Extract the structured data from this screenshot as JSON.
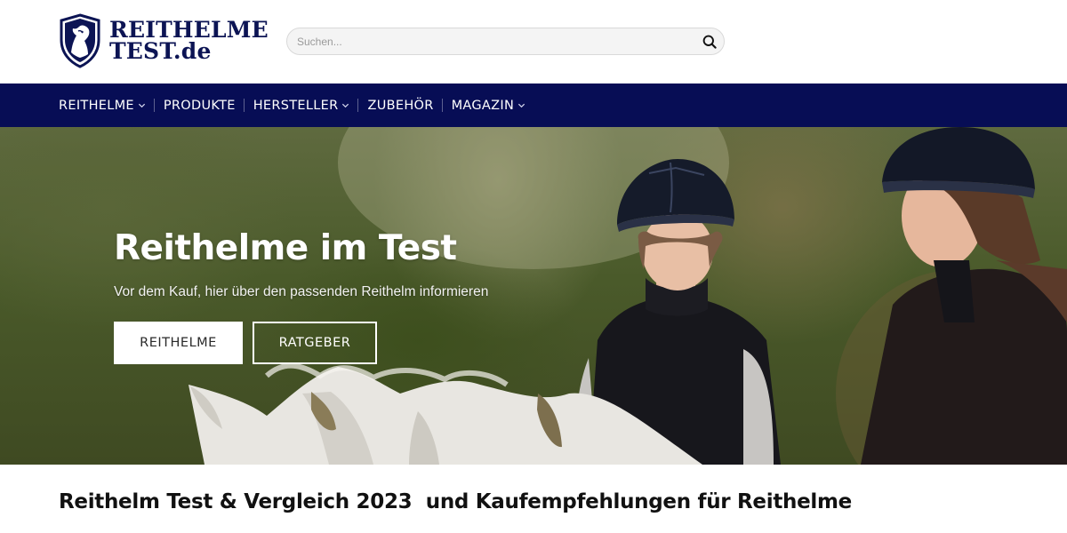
{
  "header": {
    "logo": {
      "line1": "REITHELME",
      "line2": "TEST.de",
      "icon": "horse-shield-icon"
    },
    "search": {
      "placeholder": "Suchen...",
      "icon": "search-icon"
    }
  },
  "nav": {
    "items": [
      {
        "label": "REITHELME",
        "has_dropdown": true
      },
      {
        "label": "PRODUKTE",
        "has_dropdown": false
      },
      {
        "label": "HERSTELLER",
        "has_dropdown": true
      },
      {
        "label": "ZUBEHÖR",
        "has_dropdown": false
      },
      {
        "label": "MAGAZIN",
        "has_dropdown": true
      }
    ]
  },
  "hero": {
    "title": "Reithelme im Test",
    "subtitle": "Vor dem Kauf, hier über den passenden Reithelm informieren",
    "primary_button": "REITHELME",
    "secondary_button": "RATGEBER"
  },
  "content": {
    "heading": "Reithelm Test & Vergleich 2023  und Kaufempfehlungen für Reithelme"
  },
  "colors": {
    "brand_navy": "#070d55",
    "logo_navy": "#0c1454",
    "hero_text": "#ffffff"
  }
}
